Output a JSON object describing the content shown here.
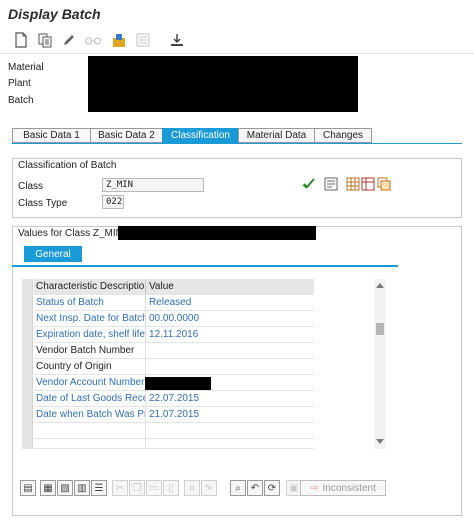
{
  "window": {
    "title": "Display Batch"
  },
  "toolbar": {
    "icons": [
      "new-document-icon",
      "display-change-icon",
      "pencil-icon",
      "glasses-icon",
      "classification-icon",
      "list-icon",
      "download-icon"
    ]
  },
  "header": {
    "material_label": "Material",
    "plant_label": "Plant",
    "batch_label": "Batch"
  },
  "tabs": [
    {
      "label": "Basic Data 1",
      "active": false
    },
    {
      "label": "Basic Data 2",
      "active": false
    },
    {
      "label": "Classification",
      "active": true
    },
    {
      "label": "Material Data",
      "active": false
    },
    {
      "label": "Changes",
      "active": false
    }
  ],
  "classification": {
    "title": "Classification of Batch",
    "class_label": "Class",
    "class_value": "Z_MIN",
    "class_type_label": "Class Type",
    "class_type_value": "022"
  },
  "values_section": {
    "title": "Values for Class Z_MIN -",
    "subtab": "General",
    "columns": [
      "Characteristic Description",
      "Value"
    ],
    "rows": [
      {
        "desc": "Status of Batch",
        "value": "Released"
      },
      {
        "desc": "Next Insp. Date for Batch",
        "value": "00.00.0000"
      },
      {
        "desc": "Expiration date, shelf life",
        "value": "12.11.2016"
      },
      {
        "desc": "Vendor Batch Number",
        "value": ""
      },
      {
        "desc": "Country of Origin",
        "value": ""
      },
      {
        "desc": "Vendor Account Number",
        "value": ""
      },
      {
        "desc": "Date of Last Goods Recei...",
        "value": "22.07.2015"
      },
      {
        "desc": "Date when Batch Was Pr...",
        "value": "21.07.2015"
      },
      {
        "desc": "",
        "value": ""
      },
      {
        "desc": "",
        "value": ""
      }
    ]
  },
  "bottom_toolbar": {
    "inconsistent_label": "Inconsistent"
  },
  "colors": {
    "accent": "#1a9ad6",
    "link_text": "#2f6fb8",
    "redaction": "#000000"
  }
}
